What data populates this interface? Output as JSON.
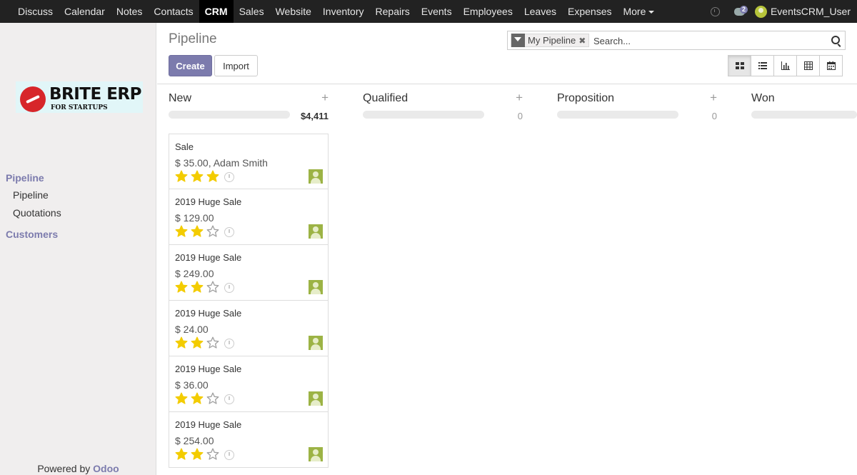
{
  "topnav": {
    "items": [
      "Discuss",
      "Calendar",
      "Notes",
      "Contacts",
      "CRM",
      "Sales",
      "Website",
      "Inventory",
      "Repairs",
      "Events",
      "Employees",
      "Leaves",
      "Expenses",
      "More"
    ],
    "active": "CRM",
    "messages_count": "2",
    "user_name": "EventsCRM_User"
  },
  "sidebar": {
    "logo_brand": "BRITE ERP",
    "logo_tagline": "FOR STARTUPS",
    "section_pipeline": "Pipeline",
    "link_pipeline": "Pipeline",
    "link_quotations": "Quotations",
    "section_customers": "Customers",
    "powered_prefix": "Powered by",
    "powered_brand": "Odoo"
  },
  "control": {
    "breadcrumb": "Pipeline",
    "create_label": "Create",
    "import_label": "Import",
    "search_facet": "My Pipeline",
    "search_placeholder": "Search...",
    "active_view": "kanban",
    "views": [
      "kanban",
      "list",
      "graph",
      "pivot",
      "calendar"
    ]
  },
  "colors": {
    "accent": "#7c7bad",
    "star_filled": "#f3cc00",
    "star_empty": "#a0a0a0",
    "topbar": "#222222"
  },
  "columns": [
    {
      "title": "New",
      "total": "$4,411"
    },
    {
      "title": "Qualified",
      "total": "0"
    },
    {
      "title": "Proposition",
      "total": "0"
    },
    {
      "title": "Won",
      "total": ""
    }
  ],
  "cards": [
    {
      "name": "Sale",
      "sub": "$ 35.00, Adam Smith",
      "stars": 3
    },
    {
      "name": "2019 Huge Sale",
      "sub": "$ 129.00",
      "stars": 2
    },
    {
      "name": "2019 Huge Sale",
      "sub": "$ 249.00",
      "stars": 2
    },
    {
      "name": "2019 Huge Sale",
      "sub": "$ 24.00",
      "stars": 2
    },
    {
      "name": "2019 Huge Sale",
      "sub": "$ 36.00",
      "stars": 2
    },
    {
      "name": "2019 Huge Sale",
      "sub": "$ 254.00",
      "stars": 2
    }
  ]
}
